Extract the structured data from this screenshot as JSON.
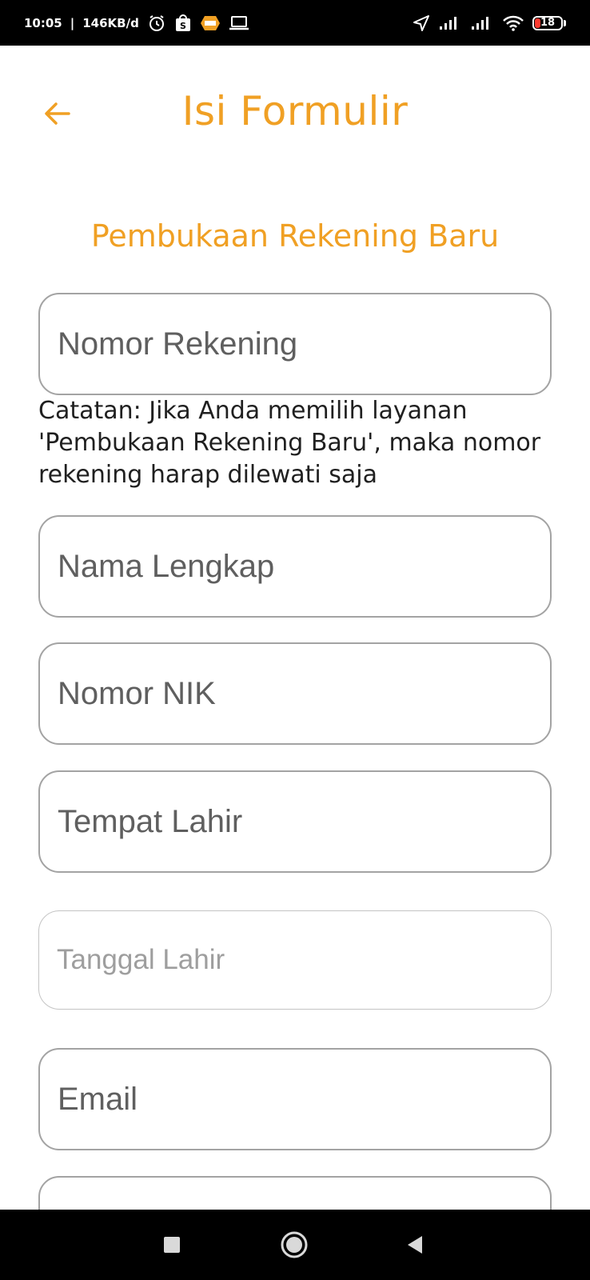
{
  "status_bar": {
    "time": "10:05",
    "net_speed": "146KB/d",
    "battery_level": "18",
    "icons": [
      "alarm-icon",
      "shopee-icon",
      "sin-app-icon",
      "laptop-icon",
      "location-arrow-icon",
      "signal-icon",
      "signal-icon",
      "wifi-icon",
      "battery-icon"
    ]
  },
  "header": {
    "title": "Isi Formulir",
    "back_icon": "arrow-left-icon"
  },
  "form": {
    "subtitle": "Pembukaan Rekening Baru",
    "fields": {
      "account_number": "Nomor Rekening",
      "full_name": "Nama Lengkap",
      "nik": "Nomor NIK",
      "birth_place": "Tempat Lahir",
      "birth_date": "Tanggal Lahir",
      "email": "Email"
    },
    "note": "Catatan: Jika Anda memilih layanan 'Pembukaan Rekening Baru', maka nomor rekening harap dilewati saja"
  },
  "nav_bar": {
    "icons": [
      "recents-square-icon",
      "home-circle-icon",
      "back-triangle-icon"
    ]
  },
  "colors": {
    "accent": "#F0A024",
    "field_border": "#a3a3a3",
    "status_bar_bg": "#000000"
  }
}
